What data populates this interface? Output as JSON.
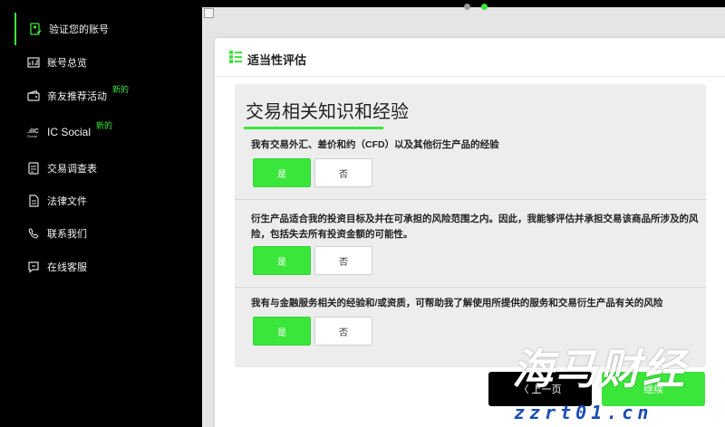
{
  "sidebar": {
    "items": [
      {
        "label": "验证您的账号",
        "icon": "verify-account-icon",
        "active": true
      },
      {
        "label": "账号总览",
        "icon": "account-overview-icon"
      },
      {
        "label": "亲友推荐活动",
        "icon": "referral-wallet-icon",
        "badge": "新的"
      },
      {
        "label": "IC Social",
        "icon": "ic-social-logo",
        "badge": "新的"
      },
      {
        "label": "交易调查表",
        "icon": "survey-icon"
      },
      {
        "label": "法律文件",
        "icon": "legal-document-icon"
      },
      {
        "label": "联系我们",
        "icon": "contact-icon"
      },
      {
        "label": "在线客服",
        "icon": "live-chat-icon"
      }
    ]
  },
  "card": {
    "title": "适当性评估",
    "icon": "assessment-list-icon"
  },
  "section": {
    "title": "交易相关知识和经验",
    "questions": [
      {
        "text": "我有交易外汇、差价和约（CFD）以及其他衍生产品的经验",
        "yes": "是",
        "no": "否",
        "selected": "yes"
      },
      {
        "text": "衍生产品适合我的投资目标及并在可承担的风险范围之内。因此，我能够评估并承担交易该商品所涉及的风险，包括失去所有投资金额的可能性。",
        "yes": "是",
        "no": "否",
        "selected": "yes"
      },
      {
        "text": "我有与金融服务相关的经验和/或资质，可帮助我了解使用所提供的服务和交易衍生产品有关的风险",
        "yes": "是",
        "no": "否",
        "selected": "yes"
      }
    ]
  },
  "footer": {
    "prev_label": "〈 上一页",
    "next_label": "继续"
  },
  "watermark": {
    "main": "海马财经",
    "sub": "zzrt01.cn"
  },
  "colors": {
    "accent": "#3be63b",
    "sidebar_bg": "#000000",
    "main_bg": "#e5e5e5"
  }
}
